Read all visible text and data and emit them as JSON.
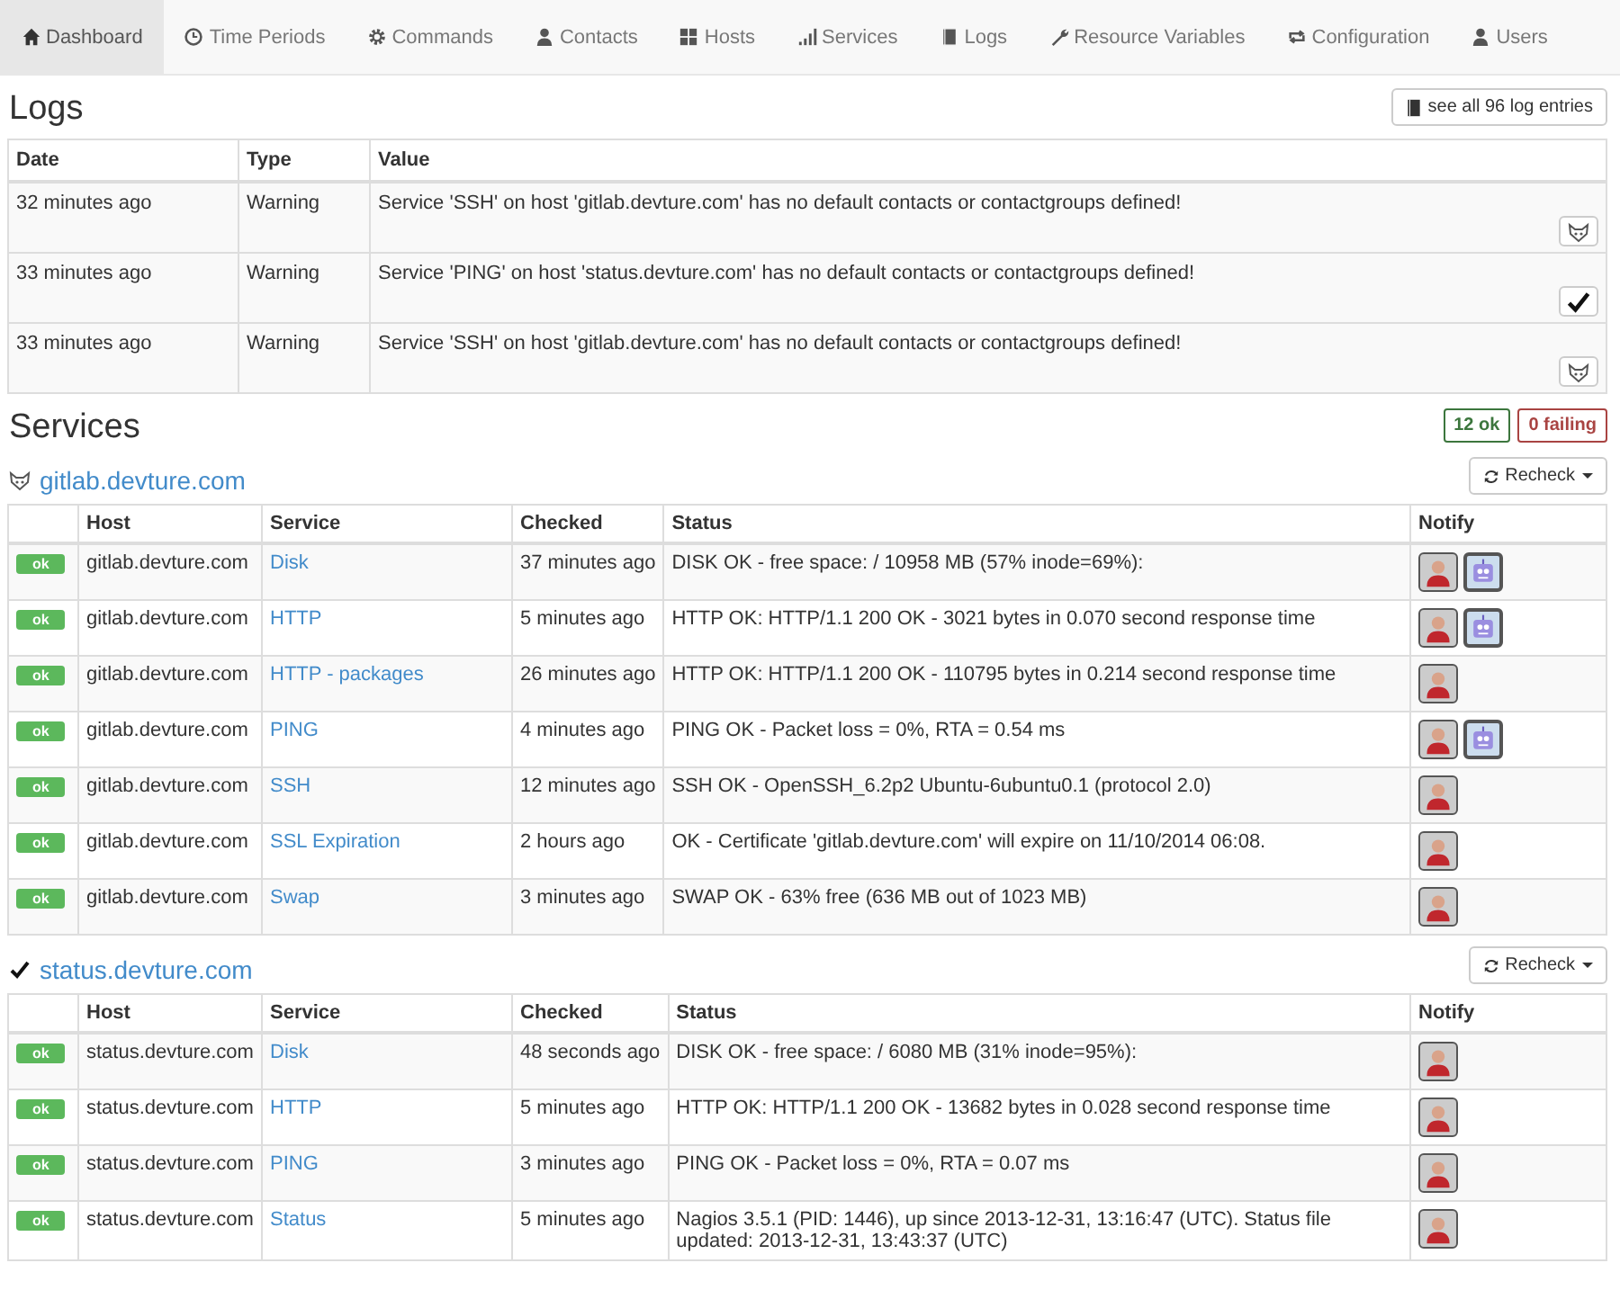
{
  "nav": [
    {
      "label": "Dashboard",
      "selected": true
    },
    {
      "label": "Time Periods",
      "selected": false
    },
    {
      "label": "Commands",
      "selected": false
    },
    {
      "label": "Contacts",
      "selected": false
    },
    {
      "label": "Hosts",
      "selected": false
    },
    {
      "label": "Services",
      "selected": false
    },
    {
      "label": "Logs",
      "selected": false
    },
    {
      "label": "Resource Variables",
      "selected": false
    },
    {
      "label": "Configuration",
      "selected": false
    },
    {
      "label": "Users",
      "selected": false
    }
  ],
  "logs": {
    "title": "Logs",
    "see_all": "see all 96 log entries",
    "columns": [
      "Date",
      "Type",
      "Value"
    ],
    "rows": [
      {
        "date": "32 minutes ago",
        "type": "Warning",
        "value": "Service 'SSH' on host 'gitlab.devture.com' has no default contacts or contactgroups defined!",
        "kind": "cat"
      },
      {
        "date": "33 minutes ago",
        "type": "Warning",
        "value": "Service 'PING' on host 'status.devture.com' has no default contacts or contactgroups defined!",
        "kind": "check"
      },
      {
        "date": "33 minutes ago",
        "type": "Warning",
        "value": "Service 'SSH' on host 'gitlab.devture.com' has no default contacts or contactgroups defined!",
        "kind": "cat"
      }
    ]
  },
  "services": {
    "title": "Services",
    "ok_count": "12 ok",
    "failing_count": "0 failing",
    "hosts": [
      {
        "name": "gitlab.devture.com",
        "kind": "cat",
        "recheck": "Recheck",
        "columns": [
          "Host",
          "Service",
          "Checked",
          "Status",
          "Notify"
        ],
        "rows": [
          {
            "state": "ok",
            "host": "gitlab.devture.com",
            "service": "Disk",
            "checked": "37 minutes ago",
            "status": "DISK OK - free space: / 10958 MB (57% inode=69%):",
            "notify": [
              {
                "kind": "person"
              },
              {
                "kind": "bot"
              }
            ]
          },
          {
            "state": "ok",
            "host": "gitlab.devture.com",
            "service": "HTTP",
            "checked": "5 minutes ago",
            "status": "HTTP OK: HTTP/1.1 200 OK - 3021 bytes in 0.070 second response time",
            "notify": [
              {
                "kind": "person"
              },
              {
                "kind": "bot"
              }
            ]
          },
          {
            "state": "ok",
            "host": "gitlab.devture.com",
            "service": "HTTP - packages",
            "checked": "26 minutes ago",
            "status": "HTTP OK: HTTP/1.1 200 OK - 110795 bytes in 0.214 second response time",
            "notify": [
              {
                "kind": "person"
              }
            ]
          },
          {
            "state": "ok",
            "host": "gitlab.devture.com",
            "service": "PING",
            "checked": "4 minutes ago",
            "status": "PING OK - Packet loss = 0%, RTA = 0.54 ms",
            "notify": [
              {
                "kind": "person"
              },
              {
                "kind": "bot"
              }
            ]
          },
          {
            "state": "ok",
            "host": "gitlab.devture.com",
            "service": "SSH",
            "checked": "12 minutes ago",
            "status": "SSH OK - OpenSSH_6.2p2 Ubuntu-6ubuntu0.1 (protocol 2.0)",
            "notify": [
              {
                "kind": "person"
              }
            ]
          },
          {
            "state": "ok",
            "host": "gitlab.devture.com",
            "service": "SSL Expiration",
            "checked": "2 hours ago",
            "status": "OK - Certificate 'gitlab.devture.com' will expire on 11/10/2014 06:08.",
            "notify": [
              {
                "kind": "person"
              }
            ]
          },
          {
            "state": "ok",
            "host": "gitlab.devture.com",
            "service": "Swap",
            "checked": "3 minutes ago",
            "status": "SWAP OK - 63% free (636 MB out of 1023 MB)",
            "notify": [
              {
                "kind": "person"
              }
            ]
          }
        ]
      },
      {
        "name": "status.devture.com",
        "kind": "check",
        "recheck": "Recheck",
        "columns": [
          "Host",
          "Service",
          "Checked",
          "Status",
          "Notify"
        ],
        "rows": [
          {
            "state": "ok",
            "host": "status.devture.com",
            "service": "Disk",
            "checked": "48 seconds ago",
            "status": "DISK OK - free space: / 6080 MB (31% inode=95%):",
            "notify": [
              {
                "kind": "person"
              }
            ]
          },
          {
            "state": "ok",
            "host": "status.devture.com",
            "service": "HTTP",
            "checked": "5 minutes ago",
            "status": "HTTP OK: HTTP/1.1 200 OK - 13682 bytes in 0.028 second response time",
            "notify": [
              {
                "kind": "person"
              }
            ]
          },
          {
            "state": "ok",
            "host": "status.devture.com",
            "service": "PING",
            "checked": "3 minutes ago",
            "status": "PING OK - Packet loss = 0%, RTA = 0.07 ms",
            "notify": [
              {
                "kind": "person"
              }
            ]
          },
          {
            "state": "ok",
            "host": "status.devture.com",
            "service": "Status",
            "checked": "5 minutes ago",
            "status": "Nagios 3.5.1 (PID: 1446), up since 2013-12-31, 13:16:47 (UTC). Status file updated: 2013-12-31, 13:43:37 (UTC)",
            "notify": [
              {
                "kind": "person"
              }
            ]
          }
        ]
      }
    ]
  }
}
